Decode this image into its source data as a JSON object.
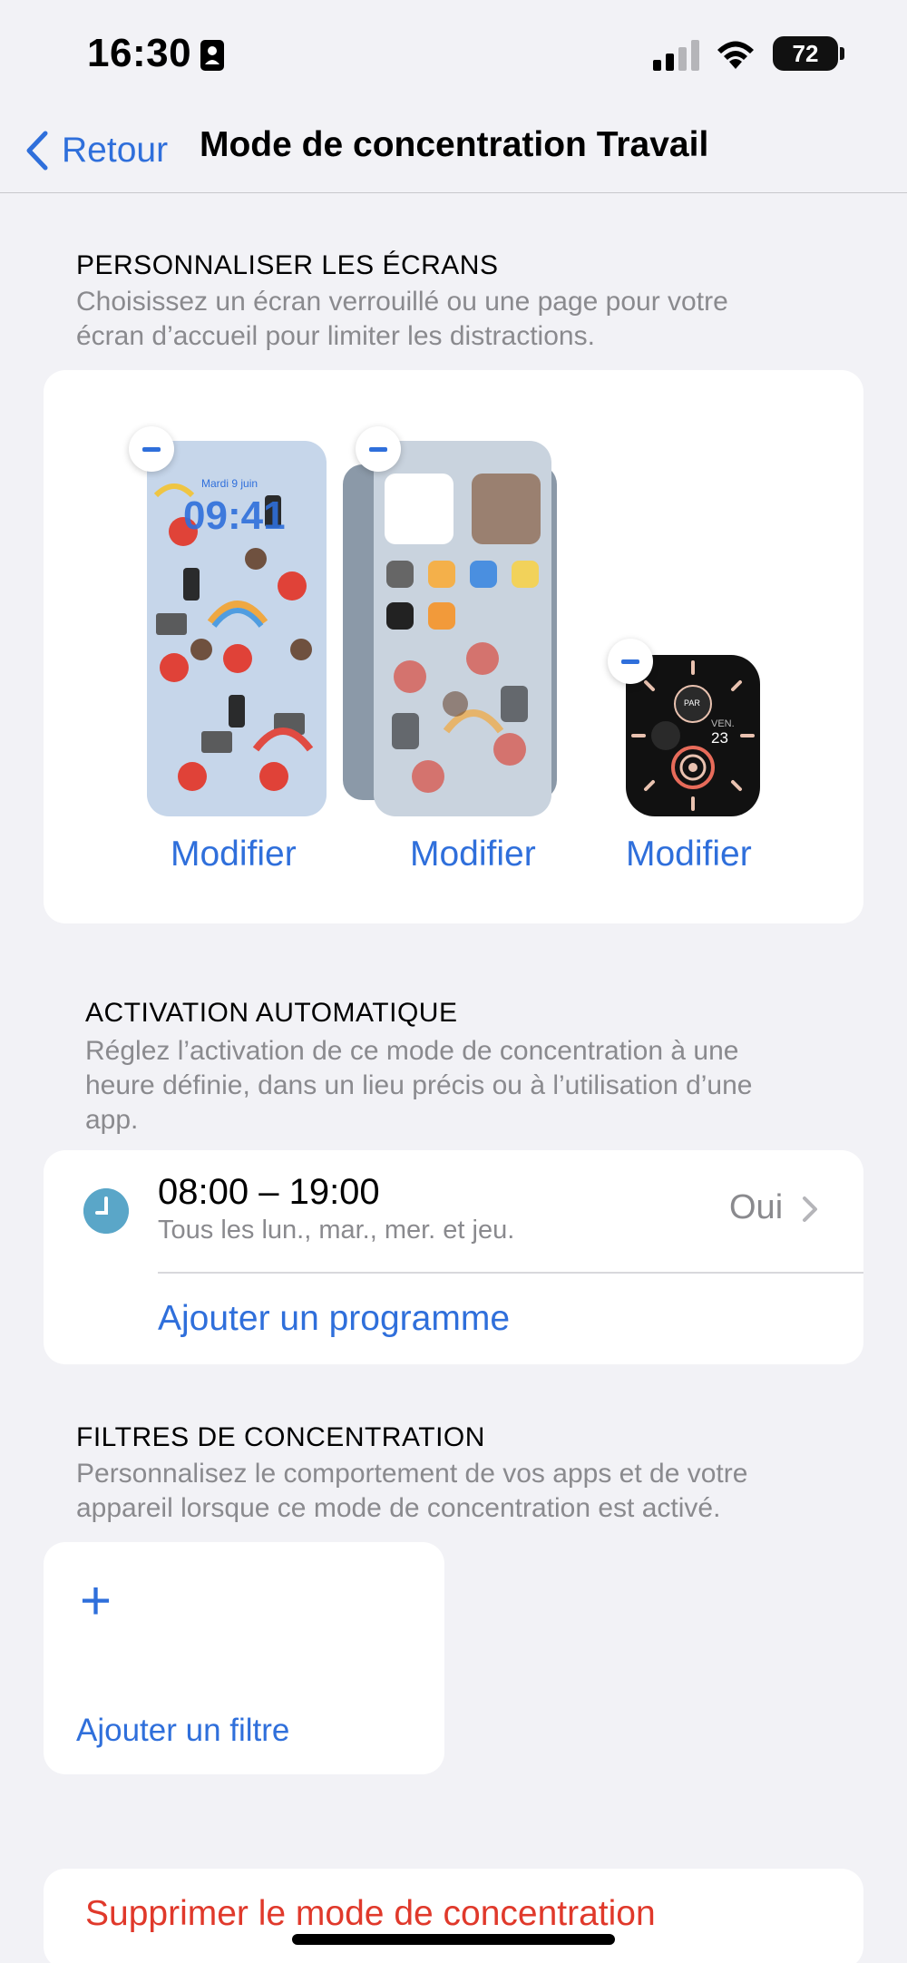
{
  "status_bar": {
    "time": "16:30",
    "battery": "72"
  },
  "nav": {
    "back_label": "Retour",
    "title": "Mode de concentration Travail"
  },
  "screens": {
    "header": "PERSONNALISER LES ÉCRANS",
    "footer_line1": "Choisissez un écran verrouillé ou une page pour votre",
    "footer_line2": "écran d’accueil pour limiter les distractions.",
    "lock_screen": {
      "time": "09:41",
      "date": "Mardi 9 juin"
    },
    "watch": {
      "day": "VEN.",
      "date": "23",
      "label": "PAR"
    },
    "modifier_labels": [
      "Modifier",
      "Modifier",
      "Modifier"
    ]
  },
  "automation": {
    "header": "ACTIVATION AUTOMATIQUE",
    "footer_line1": "Réglez l’activation de ce mode de concentration à une",
    "footer_line2": "heure définie, dans un lieu précis ou à l’utilisation d’une",
    "footer_line3": "app.",
    "schedule": {
      "time": "08:00 – 19:00",
      "days": "Tous les lun., mar., mer. et jeu.",
      "status": "Oui"
    },
    "add_schedule": "Ajouter un programme"
  },
  "filters": {
    "header": "FILTRES DE CONCENTRATION",
    "footer_line1": "Personnalisez le comportement de vos apps et de votre",
    "footer_line2": "appareil lorsque ce mode de concentration est activé.",
    "plus": "+",
    "add_filter": "Ajouter un filtre"
  },
  "delete_label": "Supprimer le mode de concentration",
  "colors": {
    "accent": "#2f6fdb",
    "destructive": "#e0392b",
    "background": "#f2f2f6",
    "secondary_text": "#8a8a8e"
  }
}
